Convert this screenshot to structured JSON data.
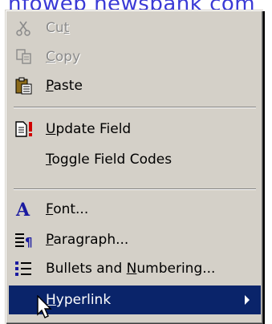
{
  "document": {
    "link_text": "nfoweb newsbank com"
  },
  "menu": {
    "items": [
      {
        "label": "Cut",
        "mnemonic": "t",
        "icon": "scissors-icon",
        "disabled": true
      },
      {
        "label": "Copy",
        "mnemonic": "C",
        "icon": "copy-icon",
        "disabled": true
      },
      {
        "label": "Paste",
        "mnemonic": "P",
        "icon": "paste-icon",
        "disabled": false
      },
      {
        "label": "Update Field",
        "mnemonic": "U",
        "icon": "update-field-icon",
        "disabled": false
      },
      {
        "label": "Toggle Field Codes",
        "mnemonic": "T",
        "icon": "",
        "disabled": false
      },
      {
        "label": "Font...",
        "mnemonic": "F",
        "icon": "font-icon",
        "disabled": false
      },
      {
        "label": "Paragraph...",
        "mnemonic": "P",
        "icon": "paragraph-icon",
        "disabled": false
      },
      {
        "label": "Bullets and Numbering...",
        "mnemonic": "N",
        "icon": "bullets-icon",
        "disabled": false
      },
      {
        "label": "Hyperlink",
        "mnemonic": "H",
        "icon": "",
        "disabled": false,
        "selected": true,
        "submenu": true
      }
    ]
  },
  "colors": {
    "menu_bg": "#d4d0c8",
    "selection_bg": "#0a246a",
    "selection_text": "#ffffff",
    "disabled_text": "#8a8a8a",
    "link_color": "#3a3ad6"
  }
}
